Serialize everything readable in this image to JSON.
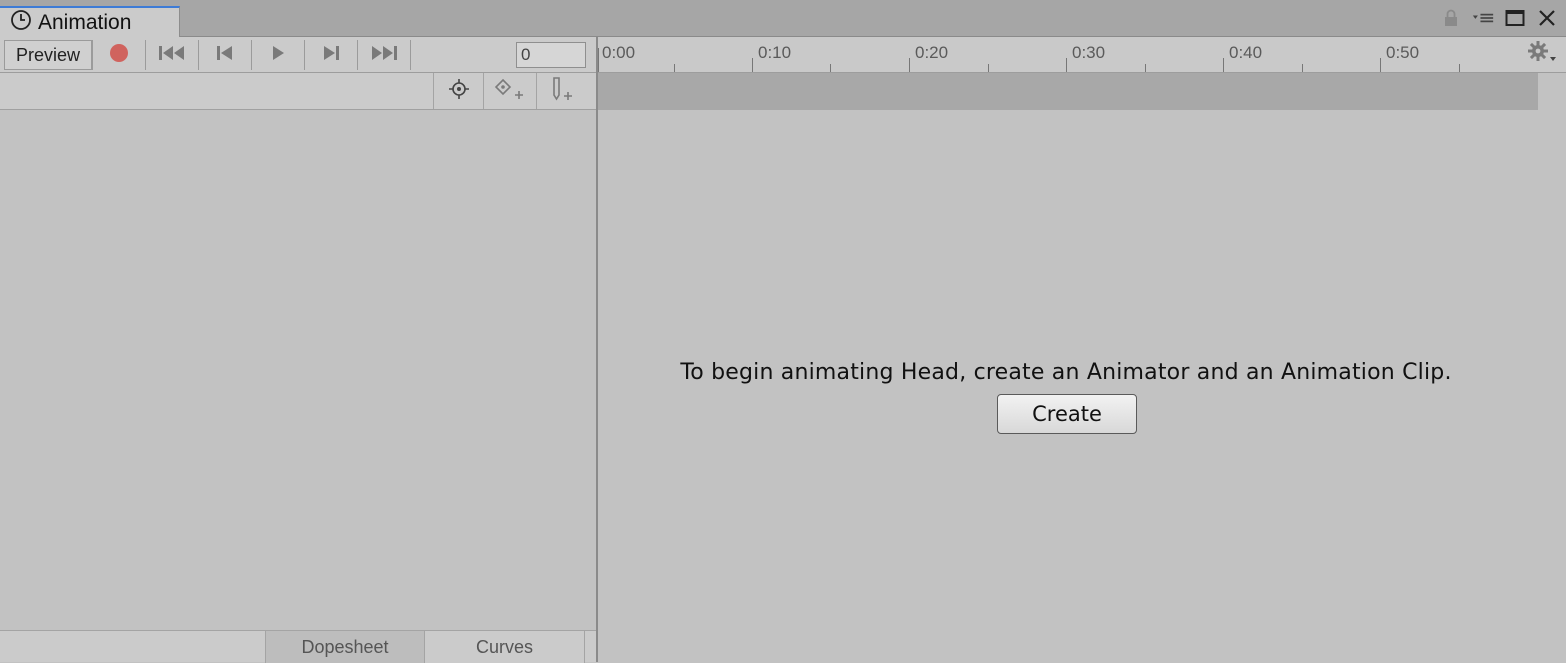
{
  "window": {
    "tab_title": "Animation",
    "icons": [
      "clock-icon",
      "lock-icon",
      "menu-icon",
      "maximize-icon",
      "close-icon"
    ]
  },
  "toolbar": {
    "preview_label": "Preview",
    "frame_value": "0",
    "buttons": [
      "record-icon",
      "first-key-icon",
      "prev-key-icon",
      "play-icon",
      "next-key-icon",
      "last-key-icon"
    ]
  },
  "property_toolbar": {
    "buttons": [
      "filter-selected-icon",
      "add-keyframe-icon",
      "add-event-icon"
    ]
  },
  "timeline": {
    "labels": [
      "0:00",
      "0:10",
      "0:20",
      "0:30",
      "0:40",
      "0:50"
    ]
  },
  "message": {
    "text": "To begin animating Head, create an Animator and an Animation Clip.",
    "create_label": "Create"
  },
  "bottom_tabs": {
    "dopesheet": "Dopesheet",
    "curves": "Curves"
  },
  "colors": {
    "accent": "#3d7bd6",
    "record": "#d0635e",
    "panel": "#c2c2c2"
  }
}
